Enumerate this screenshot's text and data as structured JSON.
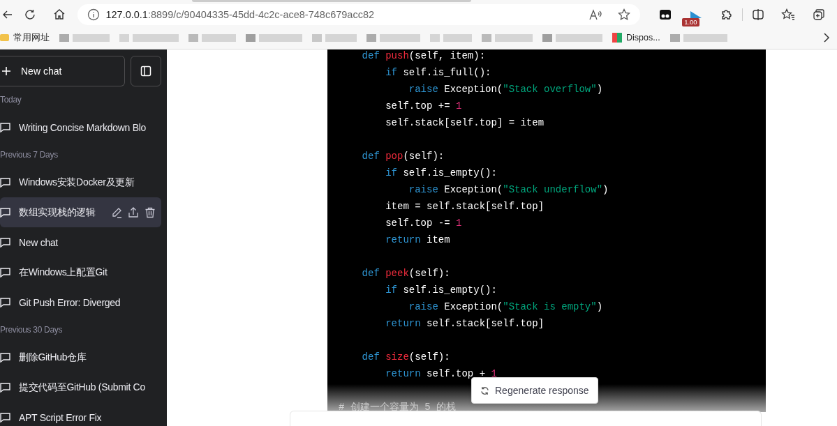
{
  "browser": {
    "url_host": "127.0.0.1",
    "url_rest": ":8899/c/90404335-45dd-4c2c-ace8-748c679acc82",
    "extension_badge": "1.00",
    "bookmarks": [
      {
        "kind": "folder",
        "label": "常用网址"
      },
      {
        "kind": "blurred"
      },
      {
        "kind": "blurred"
      },
      {
        "kind": "blurred"
      },
      {
        "kind": "blurred"
      },
      {
        "kind": "blurred"
      },
      {
        "kind": "blurred"
      },
      {
        "kind": "blurred"
      },
      {
        "kind": "blurred"
      },
      {
        "kind": "blurred"
      },
      {
        "kind": "link",
        "label": "Dispos..."
      },
      {
        "kind": "blurred"
      }
    ]
  },
  "sidebar": {
    "new_chat": "New chat",
    "items": [
      {
        "kind": "section",
        "label": "Today"
      },
      {
        "kind": "chat",
        "label": "Writing Concise Markdown Blo",
        "selected": false
      },
      {
        "kind": "section",
        "label": "Previous 7 Days"
      },
      {
        "kind": "chat",
        "label": "Windows安装Docker及更新",
        "selected": false
      },
      {
        "kind": "chat",
        "label": "数组实现栈的逻辑",
        "selected": true
      },
      {
        "kind": "chat",
        "label": "New chat",
        "selected": false
      },
      {
        "kind": "chat",
        "label": "在Windows上配置Git",
        "selected": false
      },
      {
        "kind": "chat",
        "label": "Git Push Error: Diverged",
        "selected": false
      },
      {
        "kind": "section",
        "label": "Previous 30 Days"
      },
      {
        "kind": "chat",
        "label": "删除GitHub仓库",
        "selected": false
      },
      {
        "kind": "chat",
        "label": "提交代码至GitHub (Submit Co",
        "selected": false
      },
      {
        "kind": "chat",
        "label": "APT Script Error Fix",
        "selected": false
      }
    ]
  },
  "code": {
    "lines": [
      {
        "kind": "code",
        "tokens": [
          {
            "kind": "kw",
            "text": "    def "
          },
          {
            "kind": "fn",
            "text": "push"
          },
          {
            "kind": "plain",
            "text": "(self, item):"
          }
        ]
      },
      {
        "kind": "code",
        "tokens": [
          {
            "kind": "kw",
            "text": "        if"
          },
          {
            "kind": "plain",
            "text": " self.is_full():"
          }
        ]
      },
      {
        "kind": "code",
        "tokens": [
          {
            "kind": "kw",
            "text": "            raise"
          },
          {
            "kind": "plain",
            "text": " Exception("
          },
          {
            "kind": "str",
            "text": "\"Stack overflow\""
          },
          {
            "kind": "plain",
            "text": ")"
          }
        ]
      },
      {
        "kind": "code",
        "tokens": [
          {
            "kind": "plain",
            "text": "        self.top += "
          },
          {
            "kind": "num",
            "text": "1"
          }
        ]
      },
      {
        "kind": "code",
        "tokens": [
          {
            "kind": "plain",
            "text": "        self.stack[self.top] = item"
          }
        ]
      },
      {
        "kind": "blank"
      },
      {
        "kind": "code",
        "tokens": [
          {
            "kind": "kw",
            "text": "    def "
          },
          {
            "kind": "fn",
            "text": "pop"
          },
          {
            "kind": "plain",
            "text": "(self):"
          }
        ]
      },
      {
        "kind": "code",
        "tokens": [
          {
            "kind": "kw",
            "text": "        if"
          },
          {
            "kind": "plain",
            "text": " self.is_empty():"
          }
        ]
      },
      {
        "kind": "code",
        "tokens": [
          {
            "kind": "kw",
            "text": "            raise"
          },
          {
            "kind": "plain",
            "text": " Exception("
          },
          {
            "kind": "str",
            "text": "\"Stack underflow\""
          },
          {
            "kind": "plain",
            "text": ")"
          }
        ]
      },
      {
        "kind": "code",
        "tokens": [
          {
            "kind": "plain",
            "text": "        item = self.stack[self.top]"
          }
        ]
      },
      {
        "kind": "code",
        "tokens": [
          {
            "kind": "plain",
            "text": "        self.top -= "
          },
          {
            "kind": "num",
            "text": "1"
          }
        ]
      },
      {
        "kind": "code",
        "tokens": [
          {
            "kind": "kw",
            "text": "        return"
          },
          {
            "kind": "plain",
            "text": " item"
          }
        ]
      },
      {
        "kind": "blank"
      },
      {
        "kind": "code",
        "tokens": [
          {
            "kind": "kw",
            "text": "    def "
          },
          {
            "kind": "fn",
            "text": "peek"
          },
          {
            "kind": "plain",
            "text": "(self):"
          }
        ]
      },
      {
        "kind": "code",
        "tokens": [
          {
            "kind": "kw",
            "text": "        if"
          },
          {
            "kind": "plain",
            "text": " self.is_empty():"
          }
        ]
      },
      {
        "kind": "code",
        "tokens": [
          {
            "kind": "kw",
            "text": "            raise"
          },
          {
            "kind": "plain",
            "text": " Exception("
          },
          {
            "kind": "str",
            "text": "\"Stack is empty\""
          },
          {
            "kind": "plain",
            "text": ")"
          }
        ]
      },
      {
        "kind": "code",
        "tokens": [
          {
            "kind": "kw",
            "text": "        return"
          },
          {
            "kind": "plain",
            "text": " self.stack[self.top]"
          }
        ]
      },
      {
        "kind": "blank"
      },
      {
        "kind": "code",
        "tokens": [
          {
            "kind": "kw",
            "text": "    def "
          },
          {
            "kind": "fn",
            "text": "size"
          },
          {
            "kind": "plain",
            "text": "(self):"
          }
        ]
      },
      {
        "kind": "code",
        "tokens": [
          {
            "kind": "kw",
            "text": "        return"
          },
          {
            "kind": "plain",
            "text": " self.top + "
          },
          {
            "kind": "num",
            "text": "1"
          }
        ]
      },
      {
        "kind": "blank"
      },
      {
        "kind": "code",
        "tokens": [
          {
            "kind": "comment",
            "text": "# 创建一个容量为 5 的栈"
          }
        ]
      }
    ]
  },
  "regenerate": "Regenerate response"
}
